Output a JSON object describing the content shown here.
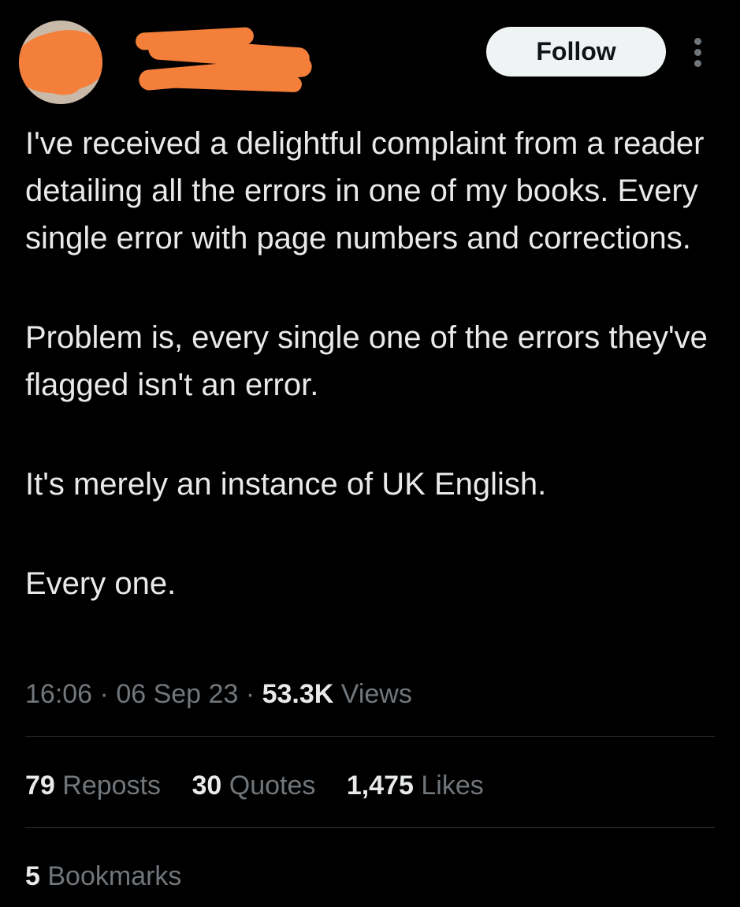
{
  "header": {
    "follow_label": "Follow"
  },
  "tweet": {
    "paragraphs": [
      "I've received a delightful complaint from a reader detailing all the errors in one of my books. Every single error with page numbers and corrections.",
      "Problem is, every single one of the errors they've flagged isn't an error.",
      "It's merely an instance of UK English.",
      "Every one."
    ]
  },
  "meta": {
    "time": "16:06",
    "separator": "·",
    "date": "06 Sep 23",
    "views_count": "53.3K",
    "views_label": "Views"
  },
  "stats": {
    "reposts_count": "79",
    "reposts_label": "Reposts",
    "quotes_count": "30",
    "quotes_label": "Quotes",
    "likes_count": "1,475",
    "likes_label": "Likes",
    "bookmarks_count": "5",
    "bookmarks_label": "Bookmarks"
  },
  "icons": {
    "more": "more-vertical-icon"
  },
  "colors": {
    "background": "#000000",
    "text_primary": "#e7e9ea",
    "text_secondary": "#71767b",
    "divider": "#2f3336",
    "follow_button_bg": "#eff3f4",
    "redaction": "#f47f3a"
  }
}
